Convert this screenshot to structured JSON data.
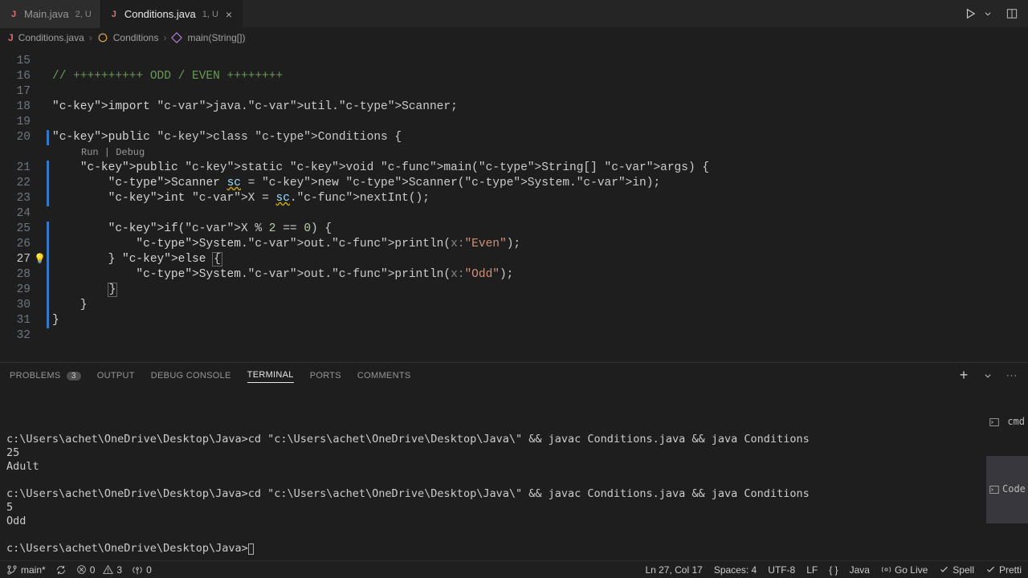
{
  "tabs": [
    {
      "name": "Main.java",
      "mods": "2, U",
      "active": false
    },
    {
      "name": "Conditions.java",
      "mods": "1, U",
      "active": true
    }
  ],
  "breadcrumbs": {
    "file": "Conditions.java",
    "class": "Conditions",
    "method": "main(String[])"
  },
  "code": {
    "codelens": "Run | Debug",
    "lines": [
      {
        "n": 15,
        "raw": ""
      },
      {
        "n": 16,
        "raw": "// ++++++++++ ODD / EVEN ++++++++"
      },
      {
        "n": 17,
        "raw": ""
      },
      {
        "n": 18,
        "raw": "import java.util.Scanner;"
      },
      {
        "n": 19,
        "raw": ""
      },
      {
        "n": 20,
        "raw": "public class Conditions {"
      },
      {
        "n": 21,
        "raw": "    public static void main(String[] args) {"
      },
      {
        "n": 22,
        "raw": "        Scanner sc = new Scanner(System.in);"
      },
      {
        "n": 23,
        "raw": "        int X = sc.nextInt();"
      },
      {
        "n": 24,
        "raw": ""
      },
      {
        "n": 25,
        "raw": "        if(X % 2 == 0) {"
      },
      {
        "n": 26,
        "raw": "            System.out.println(x:\"Even\");"
      },
      {
        "n": 27,
        "raw": "        } else {"
      },
      {
        "n": 28,
        "raw": "            System.out.println(x:\"Odd\");"
      },
      {
        "n": 29,
        "raw": "        }"
      },
      {
        "n": 30,
        "raw": "    }"
      },
      {
        "n": 31,
        "raw": "}"
      },
      {
        "n": 32,
        "raw": ""
      }
    ],
    "current_line": 27
  },
  "panel": {
    "tabs": {
      "problems": "PROBLEMS",
      "problems_count": "3",
      "output": "OUTPUT",
      "debug": "DEBUG CONSOLE",
      "terminal": "TERMINAL",
      "ports": "PORTS",
      "comments": "COMMENTS"
    },
    "terminal_sidebar": [
      {
        "label": "cmd",
        "active": false
      },
      {
        "label": "Code",
        "active": true
      }
    ],
    "terminal_lines": [
      "c:\\Users\\achet\\OneDrive\\Desktop\\Java>cd \"c:\\Users\\achet\\OneDrive\\Desktop\\Java\\\" && javac Conditions.java && java Conditions",
      "25",
      "Adult",
      "",
      "c:\\Users\\achet\\OneDrive\\Desktop\\Java>cd \"c:\\Users\\achet\\OneDrive\\Desktop\\Java\\\" && javac Conditions.java && java Conditions",
      "5",
      "Odd",
      ""
    ],
    "terminal_prompt": "c:\\Users\\achet\\OneDrive\\Desktop\\Java>"
  },
  "statusbar": {
    "branch": "main*",
    "errors": "0",
    "warnings": "3",
    "ports": "0",
    "position": "Ln 27, Col 17",
    "spaces": "Spaces: 4",
    "encoding": "UTF-8",
    "eol": "LF",
    "lang_braces": "{ }",
    "lang": "Java",
    "golive": "Go Live",
    "spell": "Spell",
    "pretti": "Pretti"
  }
}
